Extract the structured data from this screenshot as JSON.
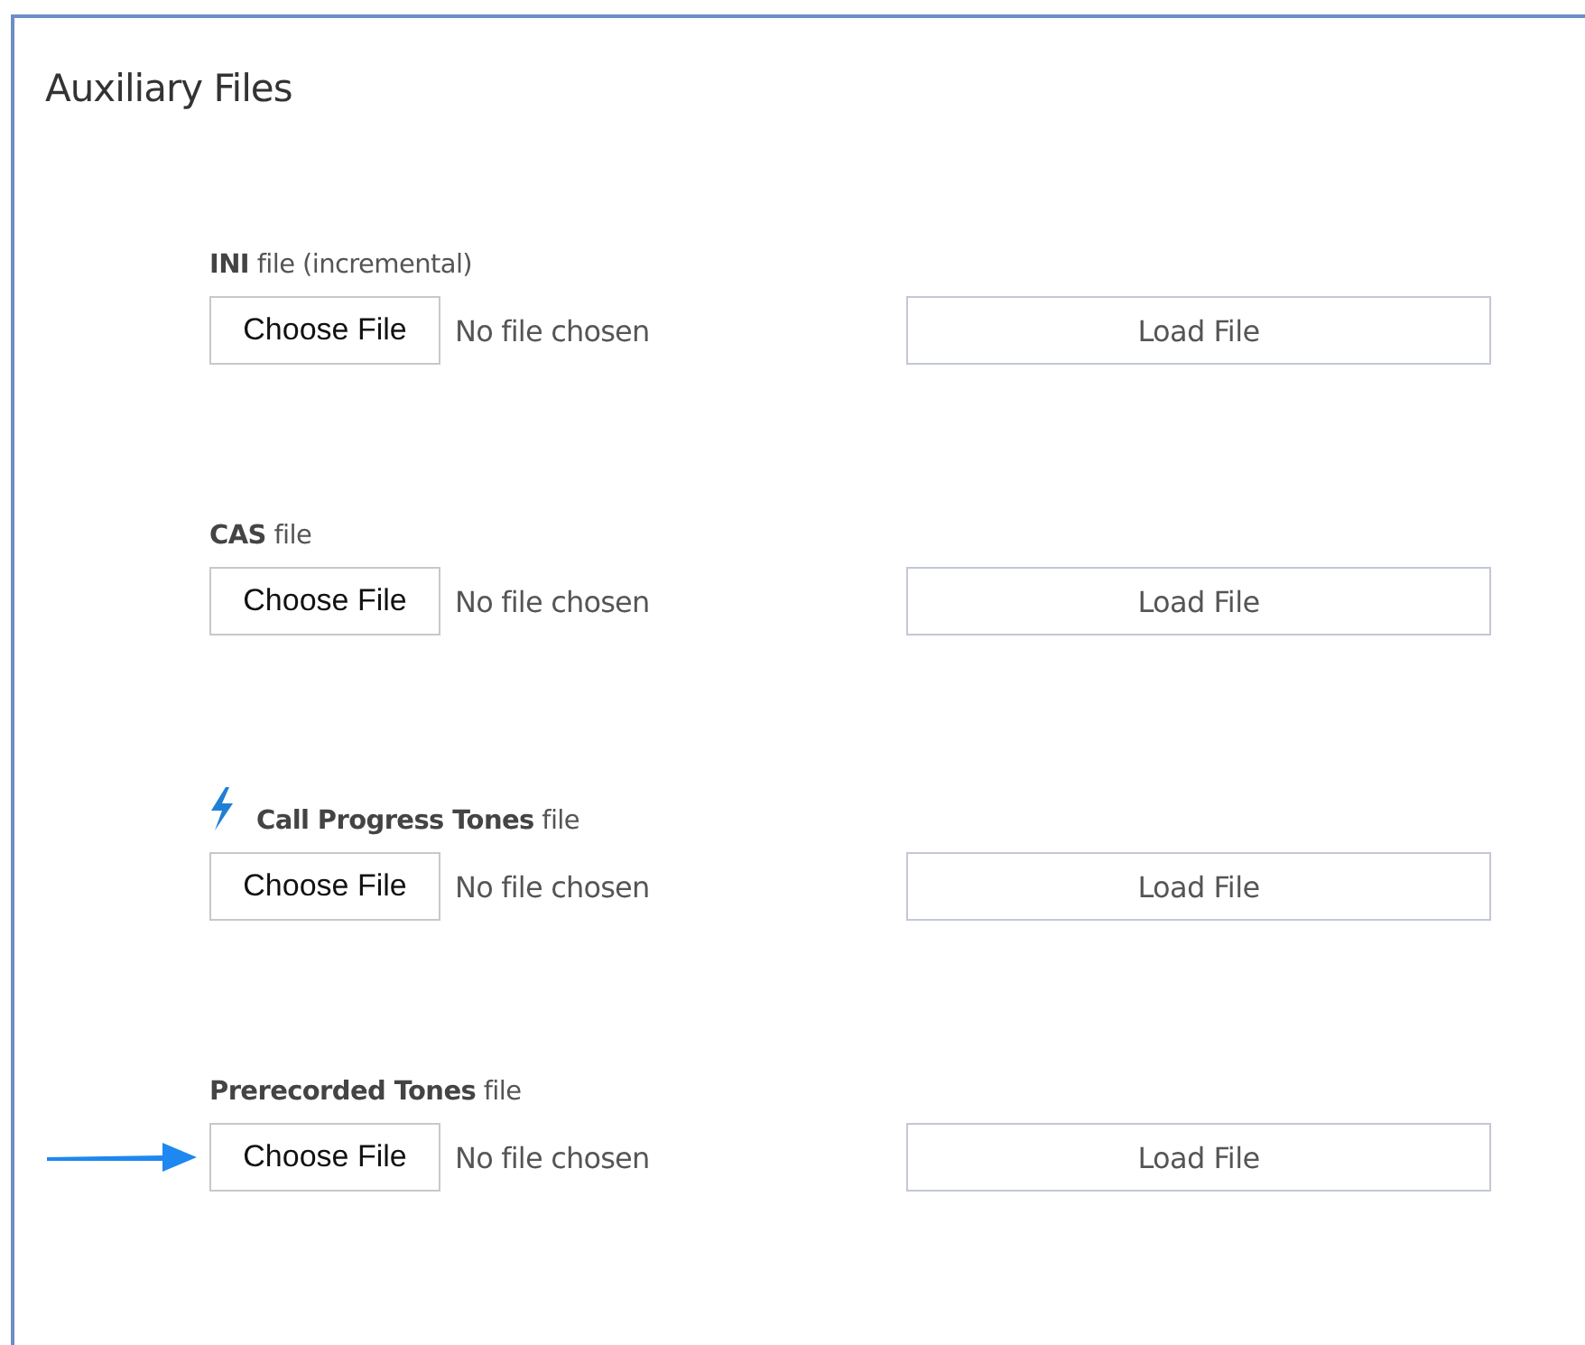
{
  "panel": {
    "title": "Auxiliary Files"
  },
  "files": [
    {
      "kind": "plain",
      "name": "INI",
      "suffix": "file (incremental)",
      "button": "Choose File",
      "status": "No file chosen",
      "load": "Load File",
      "arrow": false
    },
    {
      "kind": "plain",
      "name": "CAS",
      "suffix": "file",
      "button": "Choose File",
      "status": "No file chosen",
      "load": "Load File",
      "arrow": false
    },
    {
      "kind": "bolt",
      "name": "Call Progress Tones",
      "suffix": "file",
      "button": "Choose File",
      "status": "No file chosen",
      "load": "Load File",
      "arrow": false
    },
    {
      "kind": "plain",
      "name": "Prerecorded Tones",
      "suffix": "file",
      "button": "Choose File",
      "status": "No file chosen",
      "load": "Load File",
      "arrow": true
    }
  ]
}
